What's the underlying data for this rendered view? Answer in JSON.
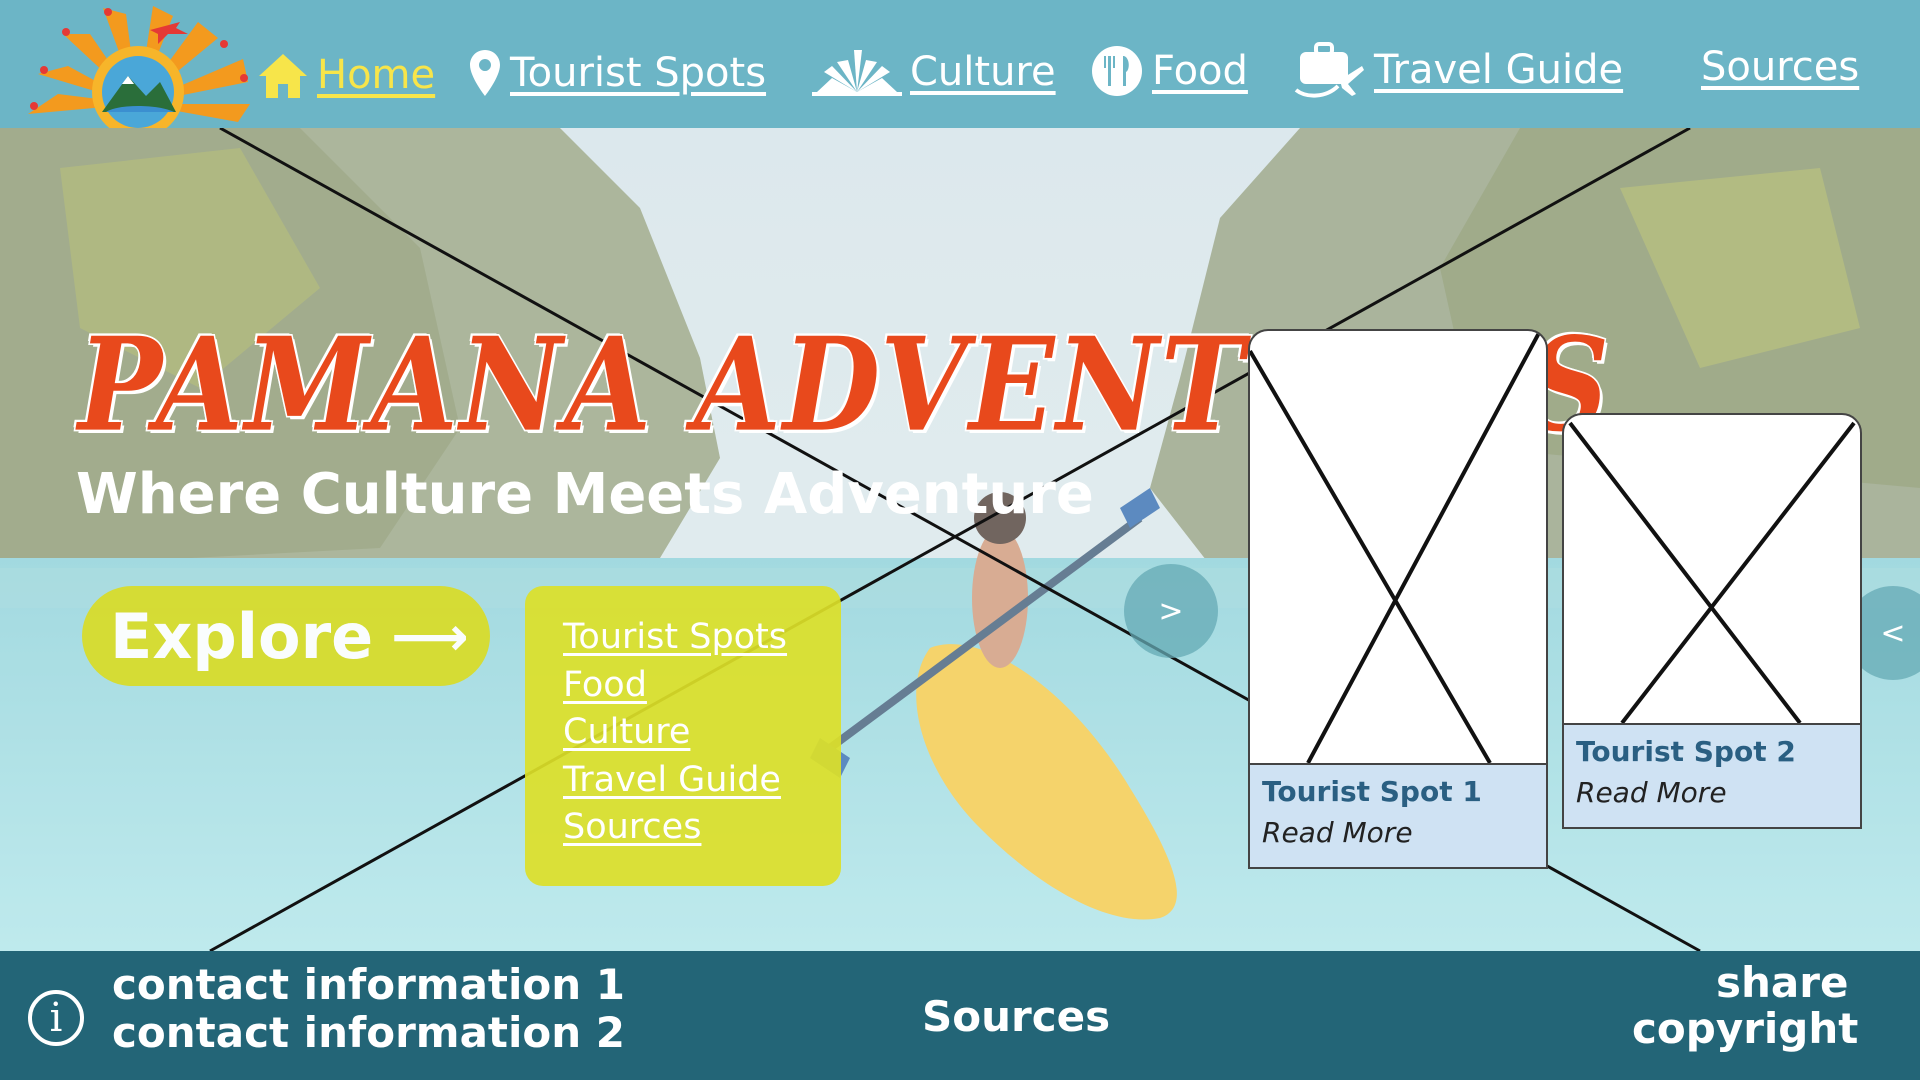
{
  "colors": {
    "header_bg": "#6cb5c6",
    "footer_bg": "#236577",
    "accent_yellow": "#d8dc2c",
    "title_orange": "#e8491c",
    "card_body": "#cfe2f3",
    "card_title": "#2a5f82"
  },
  "logo": {
    "alt_text": "PAMANA ADVENTURES",
    "icon": "sun-mountain-airplane-logo"
  },
  "nav": {
    "items": [
      {
        "label": "Home",
        "icon": "home-icon",
        "active": true
      },
      {
        "label": "Tourist Spots",
        "icon": "location-pin-icon"
      },
      {
        "label": "Culture",
        "icon": "culture-sun-icon"
      },
      {
        "label": "Food",
        "icon": "fork-knife-icon"
      },
      {
        "label": "Travel Guide",
        "icon": "suitcase-plane-icon"
      },
      {
        "label": "Sources"
      }
    ]
  },
  "hero": {
    "title": "PAMANA ADVENTURES",
    "subtitle": "Where Culture Meets Adventure",
    "explore_label": "Explore",
    "explore_arrow": "⟶",
    "dropdown": [
      "Tourist Spots",
      "Food",
      "Culture",
      "Travel Guide",
      "Sources"
    ],
    "next_label": ">",
    "prev_label": "<"
  },
  "cards": [
    {
      "title": "Tourist Spot 1",
      "link": "Read More"
    },
    {
      "title": "Tourist Spot 2",
      "link": "Read More"
    }
  ],
  "footer": {
    "info_glyph": "i",
    "contact_1": "contact information 1",
    "contact_2": "contact information 2",
    "sources": "Sources",
    "share": "share",
    "copyright": "copyright"
  }
}
